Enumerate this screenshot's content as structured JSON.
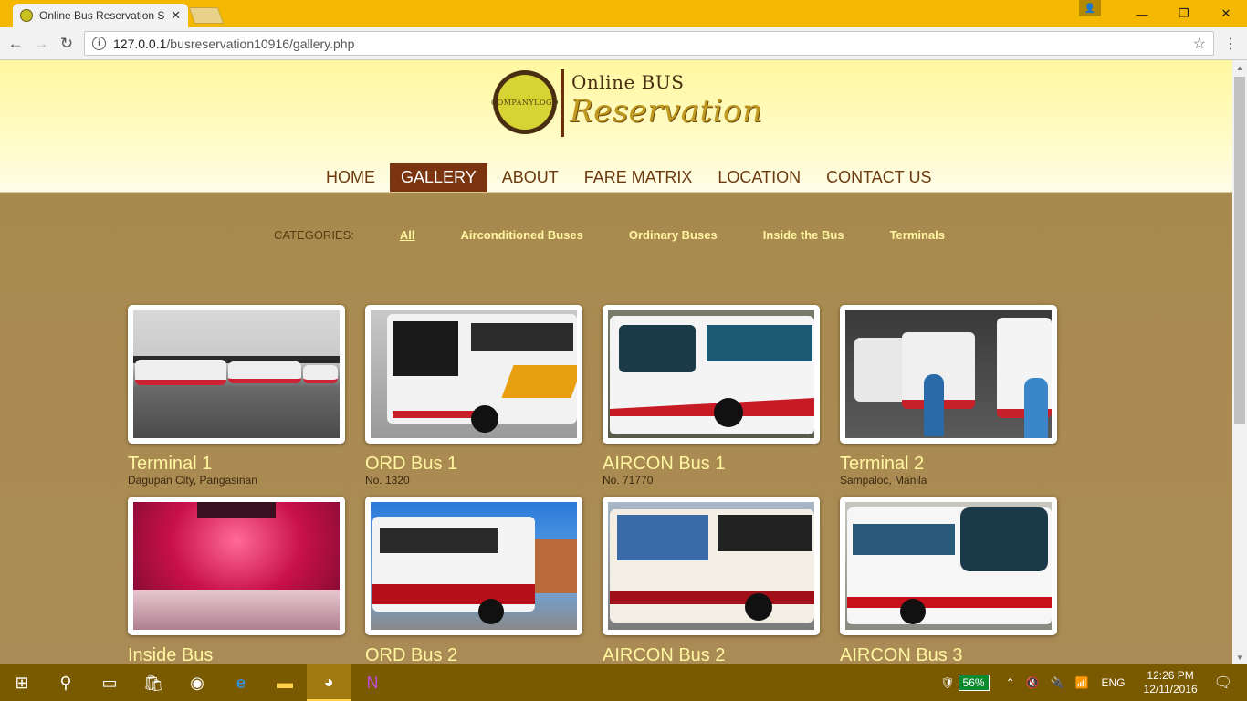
{
  "browser": {
    "tab_title": "Online Bus Reservation S",
    "url_host": "127.0.0.1",
    "url_path": "/busreservation10916/gallery.php"
  },
  "logo": {
    "line1": "COMPANY",
    "line2": "LOGO",
    "title_top": "Online BUS",
    "title_bottom": "Reservation"
  },
  "nav": {
    "items": [
      "HOME",
      "GALLERY",
      "ABOUT",
      "FARE MATRIX",
      "LOCATION",
      "CONTACT US"
    ],
    "active": "GALLERY"
  },
  "categories": {
    "label": "CATEGORIES:",
    "items": [
      "All",
      "Airconditioned Buses",
      "Ordinary Buses",
      "Inside the Bus",
      "Terminals"
    ]
  },
  "gallery": [
    {
      "title": "Terminal 1",
      "subtitle": "Dagupan City, Pangasinan"
    },
    {
      "title": "ORD Bus 1",
      "subtitle": "No. 1320"
    },
    {
      "title": "AIRCON Bus 1",
      "subtitle": "No. 71770"
    },
    {
      "title": "Terminal 2",
      "subtitle": "Sampaloc, Manila"
    },
    {
      "title": "Inside Bus",
      "subtitle": ""
    },
    {
      "title": "ORD Bus 2",
      "subtitle": ""
    },
    {
      "title": "AIRCON Bus 2",
      "subtitle": ""
    },
    {
      "title": "AIRCON Bus 3",
      "subtitle": ""
    }
  ],
  "taskbar": {
    "battery": "56%",
    "language": "ENG",
    "time": "12:26 PM",
    "date": "12/11/2016"
  },
  "colors": {
    "titlebar": "#f5b800",
    "nav_active": "#7a3410",
    "page_bg": "#a8874f",
    "caption": "#fff6a0"
  }
}
